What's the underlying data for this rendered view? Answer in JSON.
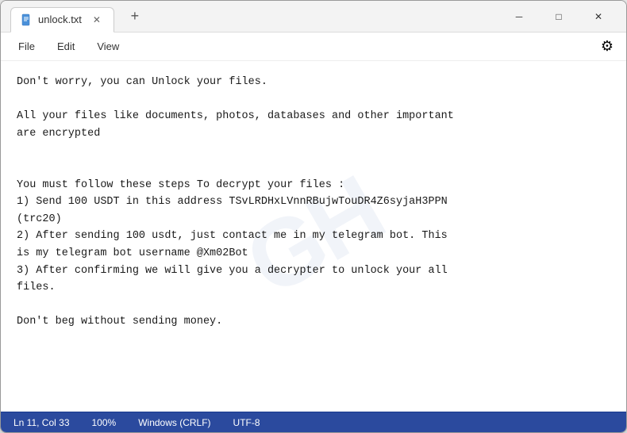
{
  "window": {
    "title": "unlock.txt",
    "tab_label": "unlock.txt"
  },
  "controls": {
    "minimize": "─",
    "maximize": "□",
    "close": "✕",
    "new_tab": "+"
  },
  "menu": {
    "items": [
      "File",
      "Edit",
      "View"
    ],
    "settings_icon": "⚙"
  },
  "content": {
    "text": "Don't worry, you can Unlock your files.\n\nAll your files like documents, photos, databases and other important\nare encrypted\n\n\nYou must follow these steps To decrypt your files :\n1) Send 100 USDT in this address TSvLRDHxLVnnRBujwTouDR4Z6syjaH3PPN\n(trc20)\n2) After sending 100 usdt, just contact me in my telegram bot. This\nis my telegram bot username @Xm02Bot\n3) After confirming we will give you a decrypter to unlock your all\nfiles.\n\nDon't beg without sending money."
  },
  "status_bar": {
    "ln_col": "Ln 11, Col 33",
    "zoom": "100%",
    "line_ending": "Windows (CRLF)",
    "encoding": "UTF-8"
  },
  "watermark": {
    "text": "GH"
  }
}
